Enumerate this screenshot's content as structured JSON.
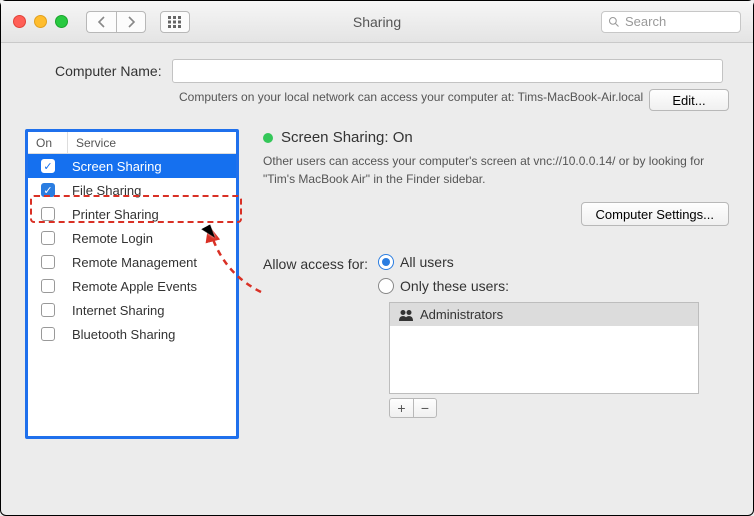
{
  "window": {
    "title": "Sharing",
    "search_placeholder": "Search"
  },
  "computer_name": {
    "label": "Computer Name:",
    "value": "",
    "access_text": "Computers on your local network can access your computer at: Tims-MacBook-Air.local",
    "edit_label": "Edit..."
  },
  "services": {
    "header_on": "On",
    "header_service": "Service",
    "items": [
      {
        "label": "Screen Sharing",
        "checked": true,
        "selected": true
      },
      {
        "label": "File Sharing",
        "checked": true,
        "selected": false
      },
      {
        "label": "Printer Sharing",
        "checked": false,
        "selected": false
      },
      {
        "label": "Remote Login",
        "checked": false,
        "selected": false
      },
      {
        "label": "Remote Management",
        "checked": false,
        "selected": false
      },
      {
        "label": "Remote Apple Events",
        "checked": false,
        "selected": false
      },
      {
        "label": "Internet Sharing",
        "checked": false,
        "selected": false
      },
      {
        "label": "Bluetooth Sharing",
        "checked": false,
        "selected": false
      }
    ]
  },
  "status": {
    "title": "Screen Sharing: On",
    "description": "Other users can access your computer's screen at vnc://10.0.0.14/ or by looking for \"Tim's MacBook Air\" in the Finder sidebar.",
    "computer_settings_label": "Computer Settings..."
  },
  "access": {
    "label": "Allow access for:",
    "all_users_label": "All users",
    "only_users_label": "Only these users:",
    "selected": "all",
    "users": [
      {
        "label": "Administrators"
      }
    ],
    "add_label": "+",
    "remove_label": "−"
  }
}
